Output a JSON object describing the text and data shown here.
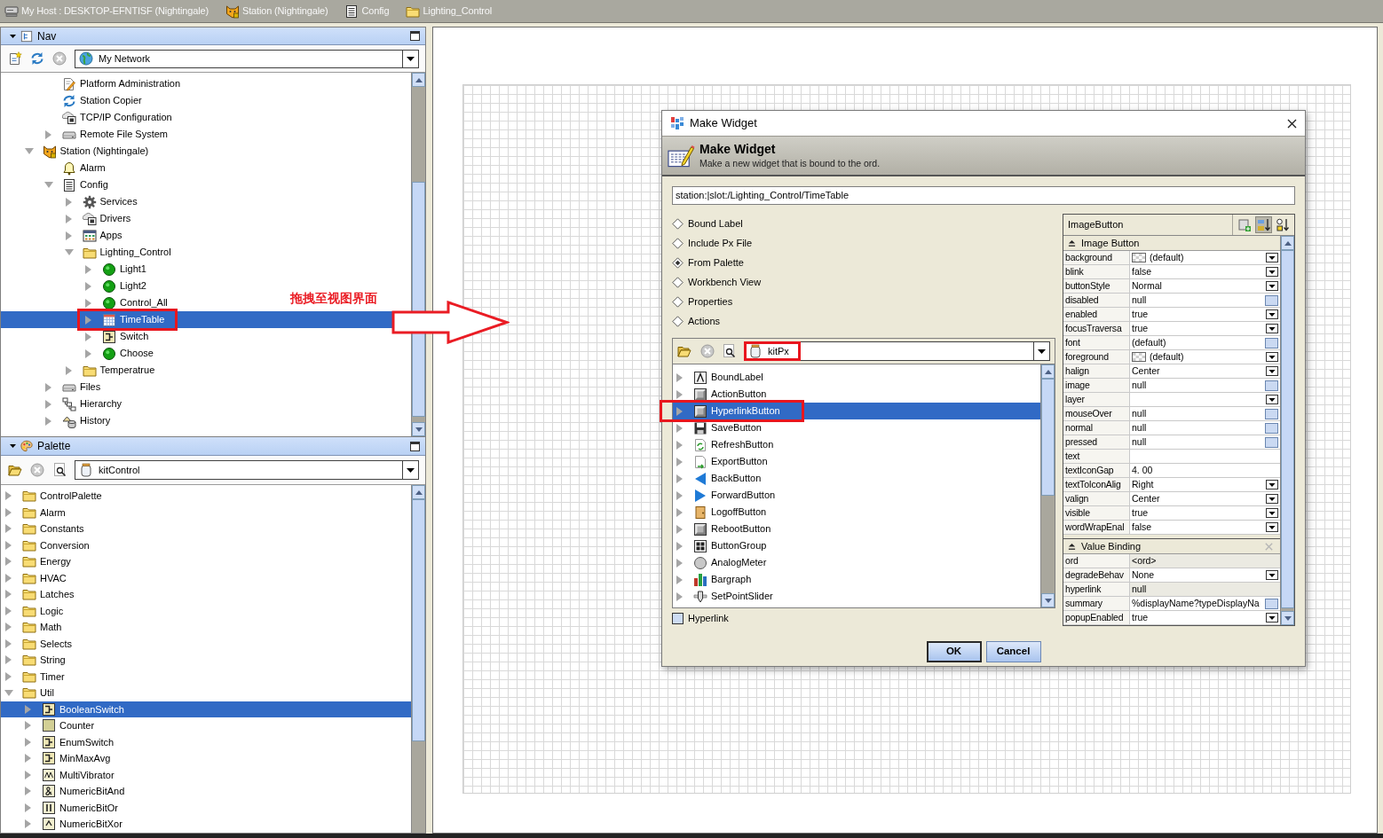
{
  "breadcrumb": [
    {
      "kind": "host",
      "label": "My Host : DESKTOP-EFNTISF (Nightingale)"
    },
    {
      "kind": "station",
      "label": "Station (Nightingale)"
    },
    {
      "kind": "list",
      "label": "Config"
    },
    {
      "kind": "folder",
      "label": "Lighting_Control"
    }
  ],
  "nav": {
    "title": "Nav",
    "location": "My Network",
    "continued_items": [
      {
        "label": "Platform Administration",
        "kind": "document-edit",
        "selected": false,
        "highlighted": false
      },
      {
        "label": "Station Copier",
        "kind": "sync",
        "selected": false,
        "highlighted": false
      },
      {
        "label": "TCP/IP Configuration",
        "kind": "network",
        "selected": false,
        "highlighted": false
      },
      {
        "label": "Remote File System",
        "kind": "drive",
        "expanded": false,
        "selected": false,
        "highlighted": false
      }
    ],
    "tree": [
      {
        "label": "Station (Nightingale)",
        "kind": "station",
        "expanded": true,
        "selected": false,
        "highlighted": false,
        "children": [
          {
            "label": "Alarm",
            "kind": "bell",
            "selected": false,
            "highlighted": false
          },
          {
            "label": "Config",
            "kind": "list",
            "expanded": true,
            "selected": false,
            "highlighted": false,
            "children": [
              {
                "label": "Services",
                "kind": "gear",
                "expanded": false,
                "selected": false,
                "highlighted": false
              },
              {
                "label": "Drivers",
                "kind": "network",
                "expanded": false,
                "selected": false,
                "highlighted": false
              },
              {
                "label": "Apps",
                "kind": "apps",
                "expanded": false,
                "selected": false,
                "highlighted": false
              },
              {
                "label": "Lighting_Control",
                "kind": "folder",
                "expanded": true,
                "selected": false,
                "highlighted": false,
                "children": [
                  {
                    "label": "Light1",
                    "kind": "point",
                    "expanded": false,
                    "selected": false,
                    "highlighted": false
                  },
                  {
                    "label": "Light2",
                    "kind": "point",
                    "expanded": false,
                    "selected": false,
                    "highlighted": false
                  },
                  {
                    "label": "Control_All",
                    "kind": "point",
                    "expanded": false,
                    "selected": false,
                    "highlighted": false
                  },
                  {
                    "label": "TimeTable",
                    "kind": "calendar",
                    "expanded": false,
                    "selected": true,
                    "highlighted": true
                  },
                  {
                    "label": "Switch",
                    "kind": "switch",
                    "expanded": false,
                    "selected": false,
                    "highlighted": false
                  },
                  {
                    "label": "Choose",
                    "kind": "point",
                    "expanded": false,
                    "selected": false,
                    "highlighted": false
                  }
                ]
              },
              {
                "label": "Temperatrue",
                "kind": "folder",
                "expanded": false,
                "selected": false,
                "highlighted": false
              }
            ]
          },
          {
            "label": "Files",
            "kind": "drive",
            "expanded": false,
            "selected": false,
            "highlighted": false
          },
          {
            "label": "Hierarchy",
            "kind": "hierarchy",
            "expanded": false,
            "selected": false,
            "highlighted": false
          },
          {
            "label": "History",
            "kind": "history",
            "expanded": false,
            "selected": false,
            "highlighted": false
          }
        ]
      }
    ]
  },
  "palette": {
    "title": "Palette",
    "module": "kitControl",
    "tree": [
      {
        "label": "ControlPalette",
        "kind": "folder",
        "expanded": false,
        "selected": false
      },
      {
        "label": "Alarm",
        "kind": "folder",
        "expanded": false,
        "selected": false
      },
      {
        "label": "Constants",
        "kind": "folder",
        "expanded": false,
        "selected": false
      },
      {
        "label": "Conversion",
        "kind": "folder",
        "expanded": false,
        "selected": false
      },
      {
        "label": "Energy",
        "kind": "folder",
        "expanded": false,
        "selected": false
      },
      {
        "label": "HVAC",
        "kind": "folder",
        "expanded": false,
        "selected": false
      },
      {
        "label": "Latches",
        "kind": "folder",
        "expanded": false,
        "selected": false
      },
      {
        "label": "Logic",
        "kind": "folder",
        "expanded": false,
        "selected": false
      },
      {
        "label": "Math",
        "kind": "folder",
        "expanded": false,
        "selected": false
      },
      {
        "label": "Selects",
        "kind": "folder",
        "expanded": false,
        "selected": false
      },
      {
        "label": "String",
        "kind": "folder",
        "expanded": false,
        "selected": false
      },
      {
        "label": "Timer",
        "kind": "folder",
        "expanded": false,
        "selected": false
      },
      {
        "label": "Util",
        "kind": "folder",
        "expanded": true,
        "selected": false,
        "children": [
          {
            "label": "BooleanSwitch",
            "kind": "switch",
            "expanded": false,
            "selected": true
          },
          {
            "label": "Counter",
            "kind": "counter",
            "expanded": false,
            "selected": false
          },
          {
            "label": "EnumSwitch",
            "kind": "switch",
            "expanded": false,
            "selected": false
          },
          {
            "label": "MinMaxAvg",
            "kind": "switch",
            "expanded": false,
            "selected": false
          },
          {
            "label": "MultiVibrator",
            "kind": "wave",
            "expanded": false,
            "selected": false
          },
          {
            "label": "NumericBitAnd",
            "kind": "bit-and",
            "expanded": false,
            "selected": false
          },
          {
            "label": "NumericBitOr",
            "kind": "bit-or",
            "expanded": false,
            "selected": false
          },
          {
            "label": "NumericBitXor",
            "kind": "bit-xor",
            "expanded": false,
            "selected": false
          }
        ]
      }
    ]
  },
  "annotation": {
    "text": "拖拽至视图界面",
    "arrow": true
  },
  "dialog": {
    "title": "Make Widget",
    "heading": "Make Widget",
    "description": "Make a new widget that is bound to the ord.",
    "ord": "station:|slot:/Lighting_Control/TimeTable",
    "options": [
      {
        "label": "Bound Label",
        "selected": false
      },
      {
        "label": "Include Px File",
        "selected": false
      },
      {
        "label": "From Palette",
        "selected": true
      },
      {
        "label": "Workbench View",
        "selected": false
      },
      {
        "label": "Properties",
        "selected": false
      },
      {
        "label": "Actions",
        "selected": false
      }
    ],
    "palette": {
      "module": "kitPx",
      "module_highlighted": true,
      "items": [
        {
          "label": "BoundLabel",
          "kind": "label",
          "expanded": false,
          "selected": false,
          "highlighted": false
        },
        {
          "label": "ActionButton",
          "kind": "button",
          "expanded": false,
          "selected": false,
          "highlighted": false
        },
        {
          "label": "HyperlinkButton",
          "kind": "button",
          "expanded": false,
          "selected": true,
          "highlighted": true
        },
        {
          "label": "SaveButton",
          "kind": "save",
          "expanded": false,
          "selected": false,
          "highlighted": false
        },
        {
          "label": "RefreshButton",
          "kind": "refresh",
          "expanded": false,
          "selected": false,
          "highlighted": false
        },
        {
          "label": "ExportButton",
          "kind": "export",
          "expanded": false,
          "selected": false,
          "highlighted": false
        },
        {
          "label": "BackButton",
          "kind": "back",
          "expanded": false,
          "selected": false,
          "highlighted": false
        },
        {
          "label": "ForwardButton",
          "kind": "forward",
          "expanded": false,
          "selected": false,
          "highlighted": false
        },
        {
          "label": "LogoffButton",
          "kind": "logoff",
          "expanded": false,
          "selected": false,
          "highlighted": false
        },
        {
          "label": "RebootButton",
          "kind": "button",
          "expanded": false,
          "selected": false,
          "highlighted": false
        },
        {
          "label": "ButtonGroup",
          "kind": "group",
          "expanded": false,
          "selected": false,
          "highlighted": false
        },
        {
          "label": "AnalogMeter",
          "kind": "meter",
          "expanded": false,
          "selected": false,
          "highlighted": false
        },
        {
          "label": "Bargraph",
          "kind": "bargraph",
          "expanded": false,
          "selected": false,
          "highlighted": false
        },
        {
          "label": "SetPointSlider",
          "kind": "slider",
          "expanded": false,
          "selected": false,
          "highlighted": false
        }
      ]
    },
    "hyperlink": {
      "label": "Hyperlink",
      "checked": false
    },
    "properties": {
      "title": "ImageButton",
      "sort_alphabetical": true,
      "sections": [
        {
          "title": "Image Button",
          "removable": false,
          "rows": [
            {
              "name": "background",
              "value": "(default)",
              "kind": "color"
            },
            {
              "name": "blink",
              "value": "false",
              "kind": "enum"
            },
            {
              "name": "buttonStyle",
              "value": "Normal",
              "kind": "enum"
            },
            {
              "name": "disabled",
              "value": "null",
              "kind": "object"
            },
            {
              "name": "enabled",
              "value": "true",
              "kind": "enum"
            },
            {
              "name": "focusTraversa",
              "value": "true",
              "kind": "enum"
            },
            {
              "name": "font",
              "value": "(default)",
              "kind": "object"
            },
            {
              "name": "foreground",
              "value": "(default)",
              "kind": "color"
            },
            {
              "name": "halign",
              "value": "Center",
              "kind": "enum"
            },
            {
              "name": "image",
              "value": "null",
              "kind": "object"
            },
            {
              "name": "layer",
              "kind": "enum"
            },
            {
              "name": "mouseOver",
              "value": "null",
              "kind": "object"
            },
            {
              "name": "normal",
              "value": "null",
              "kind": "object"
            },
            {
              "name": "pressed",
              "value": "null",
              "kind": "object"
            },
            {
              "name": "text",
              "kind": "text"
            },
            {
              "name": "textIconGap",
              "value": "4. 00",
              "kind": "text"
            },
            {
              "name": "textToIconAlig",
              "value": "Right",
              "kind": "enum"
            },
            {
              "name": "valign",
              "value": "Center",
              "kind": "enum"
            },
            {
              "name": "visible",
              "value": "true",
              "kind": "enum"
            },
            {
              "name": "wordWrapEnal",
              "value": "false",
              "kind": "enum"
            }
          ]
        },
        {
          "title": "Value Binding",
          "removable": true,
          "rows": [
            {
              "name": "ord",
              "value": "<ord>",
              "kind": "readonly"
            },
            {
              "name": "degradeBehav",
              "value": "None",
              "kind": "enum"
            },
            {
              "name": "hyperlink",
              "value": "null",
              "kind": "readonly"
            },
            {
              "name": "summary",
              "value": "%displayName?typeDisplayNa",
              "kind": "object"
            },
            {
              "name": "popupEnabled",
              "value": "true",
              "kind": "enum"
            }
          ]
        }
      ]
    },
    "buttons": [
      {
        "label": "OK",
        "default": true
      },
      {
        "label": "Cancel",
        "default": false
      }
    ]
  }
}
